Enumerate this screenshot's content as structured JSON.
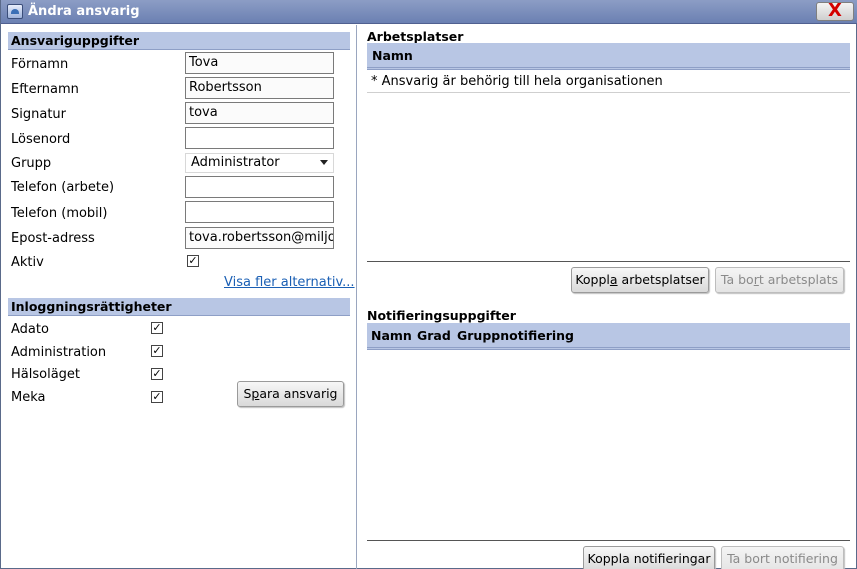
{
  "window": {
    "title": "Ändra ansvarig",
    "close_label": "X"
  },
  "left": {
    "details_header": "Ansvariguppgifter",
    "fields": [
      {
        "label": "Förnamn",
        "value": "Tova"
      },
      {
        "label": "Efternamn",
        "value": "Robertsson"
      },
      {
        "label": "Signatur",
        "value": "tova"
      },
      {
        "label": "Lösenord",
        "value": ""
      },
      {
        "label": "Grupp",
        "value": "Administrator"
      },
      {
        "label": "Telefon (arbete)",
        "value": ""
      },
      {
        "label": "Telefon (mobil)",
        "value": ""
      },
      {
        "label": "Epost-adress",
        "value": "tova.robertsson@miljoe"
      },
      {
        "label": "Aktiv",
        "value": "✓"
      }
    ],
    "more_options_link": "Visa fler alternativ...",
    "login_header": "Inloggningsrättigheter",
    "rights": [
      {
        "label": "Adato",
        "checked": "✓"
      },
      {
        "label": "Administration",
        "checked": "✓"
      },
      {
        "label": "Hälsoläget",
        "checked": "✓"
      },
      {
        "label": "Meka",
        "checked": "✓"
      }
    ],
    "save_button": {
      "pre": "S",
      "u": "p",
      "post": "ara ansvarig"
    }
  },
  "right": {
    "workplaces_title": "Arbetsplatser",
    "workplaces_columns": [
      "Namn"
    ],
    "workplaces_rows": [
      "* Ansvarig är behörig till hela organisationen"
    ],
    "connect_workplaces": {
      "pre": "Koppl",
      "u": "a",
      "post": " arbetsplatser"
    },
    "remove_workplace": {
      "pre": "Ta bo",
      "u": "r",
      "post": "t arbetsplats"
    },
    "notifications_title": "Notifieringsuppgifter",
    "notifications_columns": [
      "Namn",
      "Grad",
      "Gruppnotifiering"
    ],
    "connect_notifications": "Koppla notifieringar",
    "remove_notification": "Ta bort notifiering"
  },
  "colors": {
    "header_bg": "#b8c6e4",
    "title_bar": "#7285b9",
    "link": "#1a5fb4",
    "close_x": "#d40000"
  }
}
